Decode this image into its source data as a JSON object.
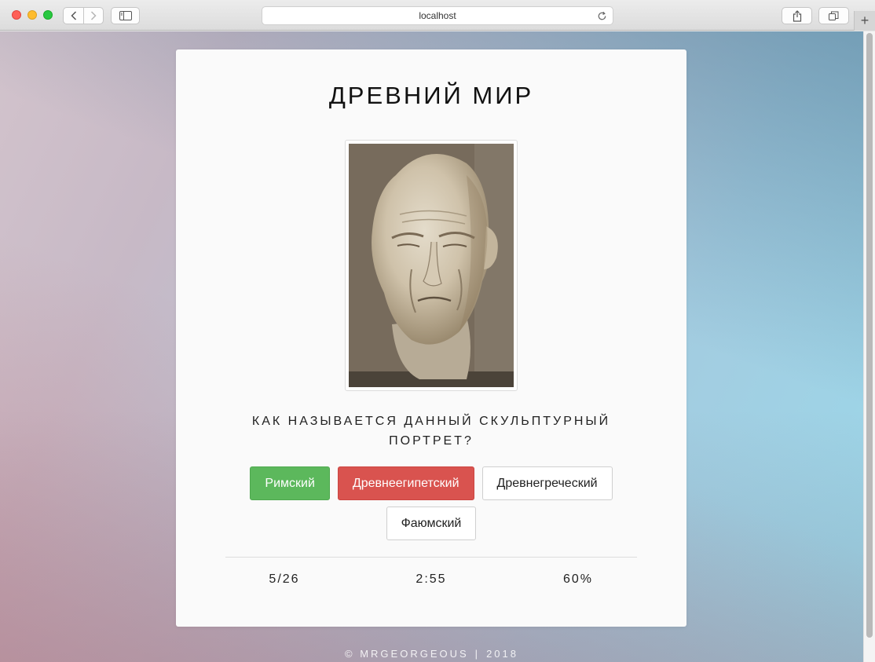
{
  "browser": {
    "address": "localhost"
  },
  "quiz": {
    "title": "ДРЕВНИЙ МИР",
    "question": "КАК НАЗЫВАЕТСЯ ДАННЫЙ СКУЛЬПТУРНЫЙ ПОРТРЕТ?",
    "answers": [
      {
        "label": "Римский",
        "state": "correct"
      },
      {
        "label": "Древнеегипетский",
        "state": "wrong"
      },
      {
        "label": "Древнегреческий",
        "state": "neutral"
      },
      {
        "label": "Фаюмский",
        "state": "neutral"
      }
    ],
    "stats": {
      "progress": "5/26",
      "timer": "2:55",
      "score": "60%"
    }
  },
  "footer": {
    "copyright": "© MRGEORGEOUS",
    "year": "2018"
  },
  "colors": {
    "correct": "#5cb85c",
    "wrong": "#d9534f"
  }
}
